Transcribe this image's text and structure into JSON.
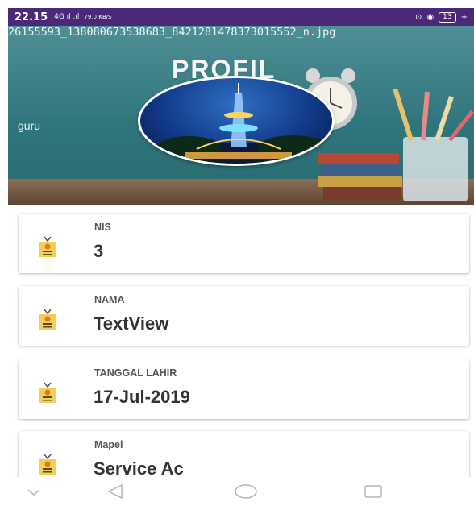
{
  "status_bar": {
    "time": "22.15",
    "signal": "4G ıl .ıl",
    "speed": "79,0 KB/S",
    "battery": "13"
  },
  "header": {
    "filename": "26155593_138080673538683_8421281478373015552_n.jpg",
    "title": "PROFIL",
    "role": "guru"
  },
  "fields": [
    {
      "label": "NIS",
      "value": "3"
    },
    {
      "label": "NAMA",
      "value": "TextView"
    },
    {
      "label": "TANGGAL LAHIR",
      "value": "17-Jul-2019"
    },
    {
      "label": "Mapel",
      "value": "Service Ac"
    }
  ],
  "icons": {
    "field_icon": "id-badge-icon",
    "nav": [
      "chevron-down-icon",
      "back-triangle-icon",
      "home-circle-icon",
      "recents-square-icon"
    ]
  },
  "colors": {
    "status_bar": "#4a2a78",
    "header": "#2f767c",
    "badge_yellow": "#f3cf5a",
    "badge_orange": "#e07b1a"
  }
}
